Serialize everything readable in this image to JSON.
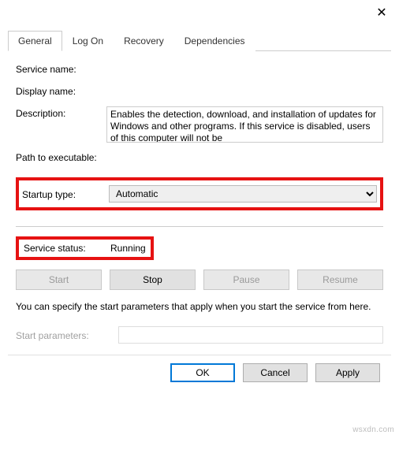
{
  "titlebar": {
    "close_glyph": "✕"
  },
  "tabs": {
    "general": "General",
    "logon": "Log On",
    "recovery": "Recovery",
    "dependencies": "Dependencies"
  },
  "labels": {
    "service_name": "Service name:",
    "display_name": "Display name:",
    "description": "Description:",
    "path": "Path to executable:",
    "startup_type": "Startup type:",
    "service_status": "Service status:",
    "start_parameters": "Start parameters:"
  },
  "description_text": "Enables the detection, download, and installation of updates for Windows and other programs. If this service is disabled, users of this computer will not be",
  "startup": {
    "selected": "Automatic"
  },
  "status": {
    "value": "Running"
  },
  "buttons": {
    "start": "Start",
    "stop": "Stop",
    "pause": "Pause",
    "resume": "Resume",
    "ok": "OK",
    "cancel": "Cancel",
    "apply": "Apply"
  },
  "hint": "You can specify the start parameters that apply when you start the service from here.",
  "watermark": "wsxdn.com"
}
